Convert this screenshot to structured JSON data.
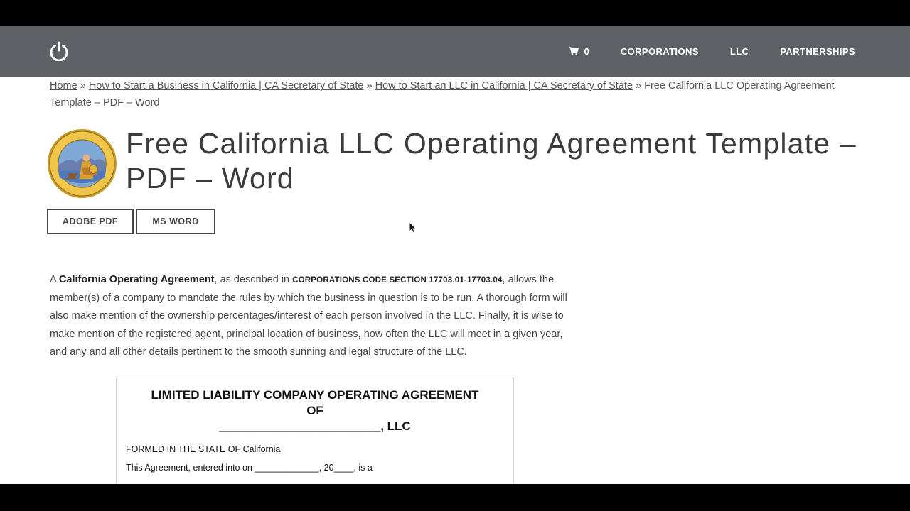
{
  "nav": {
    "cart_count": "0",
    "links": [
      "CORPORATIONS",
      "LLC",
      "PARTNERSHIPS"
    ]
  },
  "breadcrumb": {
    "home": "Home",
    "link1": "How to Start a Business in California | CA Secretary of State",
    "link2": "How to Start an LLC in California | CA Secretary of State",
    "separator": "»",
    "current": "Free California LLC Operating Agreement Template – PDF – Word"
  },
  "title": "Free California LLC Operating Agreement Template – PDF – Word",
  "buttons": {
    "pdf": "ADOBE PDF",
    "word": "MS WORD"
  },
  "intro": {
    "prefix": "A ",
    "bold": "California Operating Agreement",
    "mid": ", as described in ",
    "code": "CORPORATIONS CODE SECTION 17703.01-17703.04",
    "rest": ", allows the member(s) of a company to mandate the rules by which the business in question is to be run. A thorough form will also make mention of the ownership percentages/interest of each person involved in the LLC. Finally, it is wise to make mention of the registered agent, principal location of business, how often the LLC will meet in a given year, and any and all other details pertinent to the smooth sunning and legal structure of the LLC."
  },
  "preview": {
    "heading_line1": "LIMITED LIABILITY COMPANY OPERATING AGREEMENT",
    "heading_line2": "OF",
    "heading_line3": "________________________, LLC",
    "formed": "FORMED IN THE STATE OF California",
    "entered": "This Agreement, entered into on _____________, 20____, is a"
  },
  "colors": {
    "navbar": "#5d6064",
    "text": "#444444",
    "title": "#3b3b3b"
  },
  "icons": {
    "logo": "power-icon",
    "cart": "cart-icon",
    "seal": "california-seal"
  }
}
